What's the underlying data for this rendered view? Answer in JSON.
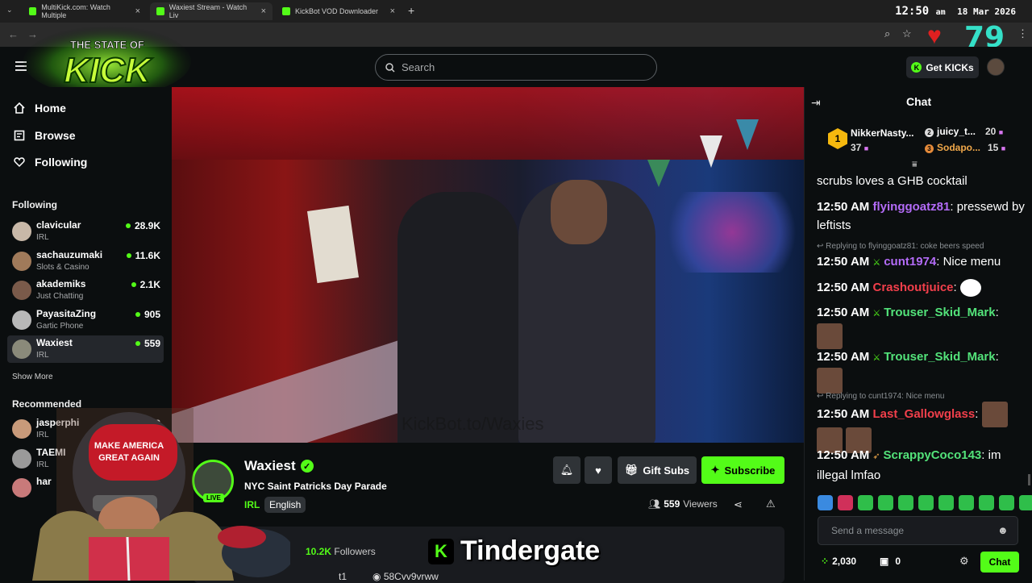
{
  "browser": {
    "tabs": [
      {
        "title": "MultiKick.com: Watch Multiple"
      },
      {
        "title": "Waxiest Stream - Watch Liv"
      },
      {
        "title": "KickBot VOD Downloader"
      }
    ],
    "clock": {
      "time": "12:50",
      "ampm": "am",
      "date": "18 Mar 2026"
    },
    "heart_count": "79"
  },
  "logo": {
    "line1": "THE STATE OF",
    "line2": "KICK"
  },
  "header": {
    "search_placeholder": "Search",
    "get_kicks": "Get KICKs"
  },
  "sidebar": {
    "nav": [
      {
        "label": "Home",
        "icon": "home-icon"
      },
      {
        "label": "Browse",
        "icon": "browse-icon"
      },
      {
        "label": "Following",
        "icon": "heart-icon"
      }
    ],
    "following_header": "Following",
    "following": [
      {
        "name": "clavicular",
        "category": "IRL",
        "viewers": "28.9K"
      },
      {
        "name": "sachauzumaki",
        "category": "Slots & Casino",
        "viewers": "11.6K"
      },
      {
        "name": "akademiks",
        "category": "Just Chatting",
        "viewers": "2.1K"
      },
      {
        "name": "PayasitaZing",
        "category": "Gartic Phone",
        "viewers": "905"
      },
      {
        "name": "Waxiest",
        "category": "IRL",
        "viewers": "559"
      }
    ],
    "show_more": "Show More",
    "recommended_header": "Recommended",
    "recommended": [
      {
        "name": "jasperphi",
        "category": "IRL",
        "viewers": "253"
      },
      {
        "name": "TAEMI",
        "category": "IRL"
      },
      {
        "name": "har",
        "category": ""
      }
    ]
  },
  "video": {
    "watermark": "KickBot.to/Waxies"
  },
  "stream": {
    "streamer": "Waxiest",
    "title": "NYC Saint Patricks Day Parade",
    "category": "IRL",
    "language": "English",
    "live_badge": "LIVE",
    "gift_subs": "Gift Subs",
    "subscribe": "Subscribe",
    "viewers_count": "559",
    "viewers_label": "Viewers",
    "followers_count": "10.2K",
    "followers_label": "Followers",
    "discord": "58Cvv9vrww",
    "partial_label": "t1"
  },
  "overlay": {
    "text": "Tindergate"
  },
  "webcam": {
    "hat_line1": "MAKE AMERICA",
    "hat_line2": "GREAT AGAIN"
  },
  "chat": {
    "title": "Chat",
    "leaderboard": [
      {
        "rank": "1",
        "name": "NikkerNasty...",
        "count": "37"
      },
      {
        "rank": "2",
        "name": "juicy_t...",
        "count": "20"
      },
      {
        "rank": "3",
        "name": "Sodapo...",
        "count": "15"
      }
    ],
    "messages": [
      {
        "time": "",
        "user": "",
        "text": "scrubs loves a GHB cocktail"
      },
      {
        "time": "12:50 AM",
        "user": "flyinggoatz81",
        "text": "pressewd by leftists"
      },
      {
        "reply": "Replying to flyinggoatz81: coke beers speed",
        "time": "12:50 AM",
        "user": "cunt1974",
        "text": "Nice menu"
      },
      {
        "time": "12:50 AM",
        "user": "Crashoutjuice",
        "text": ""
      },
      {
        "time": "12:50 AM",
        "user": "Trouser_Skid_Mark",
        "text": ""
      },
      {
        "time": "12:50 AM",
        "user": "Trouser_Skid_Mark",
        "text": ""
      },
      {
        "reply": "Replying to cunt1974: Nice menu",
        "time": "12:50 AM",
        "user": "Last_Gallowglass",
        "text": ""
      },
      {
        "time": "12:50 AM",
        "user": "ScrappyCoco143",
        "text": "im illegal lmfao"
      }
    ],
    "colors": {
      "flyinggoatz81": "#b36bf7",
      "cunt1974": "#b36bf7",
      "Crashoutjuice": "#f23f4b",
      "Trouser_Skid_Mark": "#53e37a",
      "Last_Gallowglass": "#f23f4b",
      "ScrappyCoco143": "#53e37a"
    },
    "send_placeholder": "Send a message",
    "points": "2,030",
    "gifts": "0",
    "chat_button": "Chat"
  },
  "colors": {
    "accent": "#53fc18",
    "bg": "#0b0e0f",
    "panel": "#191b1f"
  }
}
